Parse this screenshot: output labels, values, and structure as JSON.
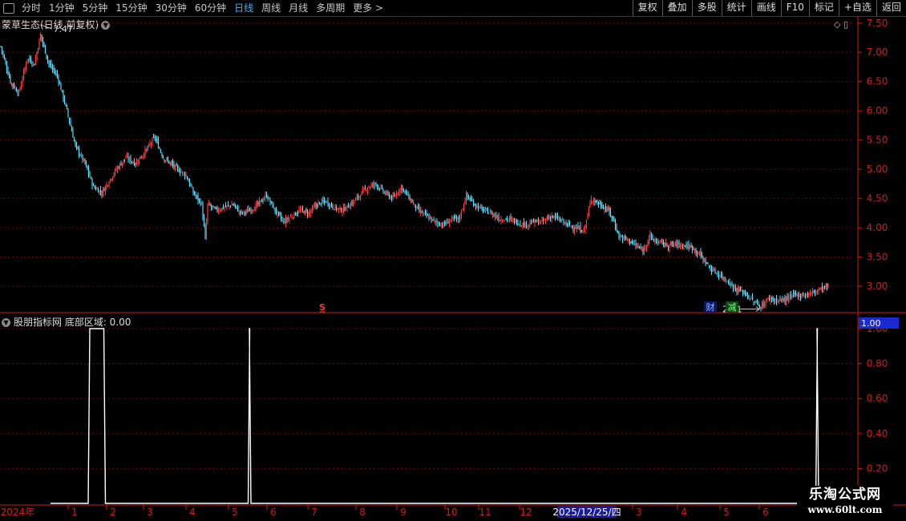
{
  "toolbar": {
    "periods": [
      "分时",
      "1分钟",
      "5分钟",
      "15分钟",
      "30分钟",
      "60分钟",
      "日线",
      "周线",
      "月线",
      "多周期",
      "更多 >"
    ],
    "active": "日线",
    "buttons": [
      "复权",
      "叠加",
      "多股",
      "统计",
      "画线",
      "F10",
      "标记",
      "+自选",
      "返回"
    ]
  },
  "main_title": "蒙草生态(日线 前复权)",
  "indicator_title": "股朋指标网 底部区域: 0.00",
  "top_icons": "◇ ▯",
  "watermark": {
    "line1": "乐淘公式网",
    "line2": "www.60lt.com"
  },
  "colors": {
    "up": "#ff3c3c",
    "down": "#54e0ff",
    "axis": "#d01c1c",
    "grid": "#7a0000",
    "indicator": "#ffffff",
    "date_highlight": "#1a1aa0"
  },
  "chart_data": [
    {
      "type": "candlestick",
      "y_ticks": [
        "7.50",
        "7.00",
        "6.50",
        "6.00",
        "5.50",
        "5.00",
        "4.50",
        "4.00",
        "3.50",
        "3.00"
      ],
      "ylim": [
        2.55,
        7.62
      ],
      "high_label": "7.47",
      "low_label": "2.61",
      "markers": [
        "S",
        "财",
        "减"
      ],
      "close_path": [
        [
          0,
          7.1
        ],
        [
          8,
          6.5
        ],
        [
          15,
          6.3
        ],
        [
          22,
          6.9
        ],
        [
          28,
          6.8
        ],
        [
          33,
          7.3
        ],
        [
          40,
          6.8
        ],
        [
          47,
          6.6
        ],
        [
          55,
          6.0
        ],
        [
          62,
          5.4
        ],
        [
          70,
          5.1
        ],
        [
          77,
          4.7
        ],
        [
          84,
          4.6
        ],
        [
          90,
          4.8
        ],
        [
          96,
          5.0
        ],
        [
          104,
          5.2
        ],
        [
          112,
          5.1
        ],
        [
          120,
          5.3
        ],
        [
          128,
          5.55
        ],
        [
          135,
          5.2
        ],
        [
          141,
          5.1
        ],
        [
          147,
          5.0
        ],
        [
          154,
          4.9
        ],
        [
          160,
          4.6
        ],
        [
          167,
          4.4
        ],
        [
          170,
          3.8
        ],
        [
          172,
          4.4
        ],
        [
          179,
          4.3
        ],
        [
          186,
          4.35
        ],
        [
          193,
          4.4
        ],
        [
          200,
          4.25
        ],
        [
          207,
          4.3
        ],
        [
          214,
          4.4
        ],
        [
          221,
          4.55
        ],
        [
          228,
          4.3
        ],
        [
          235,
          4.1
        ],
        [
          242,
          4.2
        ],
        [
          249,
          4.3
        ],
        [
          256,
          4.25
        ],
        [
          263,
          4.4
        ],
        [
          270,
          4.45
        ],
        [
          277,
          4.35
        ],
        [
          284,
          4.3
        ],
        [
          291,
          4.4
        ],
        [
          298,
          4.55
        ],
        [
          305,
          4.7
        ],
        [
          312,
          4.75
        ],
        [
          319,
          4.6
        ],
        [
          326,
          4.5
        ],
        [
          333,
          4.7
        ],
        [
          340,
          4.5
        ],
        [
          347,
          4.3
        ],
        [
          354,
          4.2
        ],
        [
          361,
          4.1
        ],
        [
          368,
          4.05
        ],
        [
          375,
          4.15
        ],
        [
          381,
          4.15
        ],
        [
          387,
          4.55
        ],
        [
          394,
          4.4
        ],
        [
          401,
          4.3
        ],
        [
          408,
          4.25
        ],
        [
          415,
          4.15
        ],
        [
          422,
          4.15
        ],
        [
          429,
          4.1
        ],
        [
          436,
          4.05
        ],
        [
          443,
          4.1
        ],
        [
          450,
          4.1
        ],
        [
          457,
          4.2
        ],
        [
          464,
          4.15
        ],
        [
          471,
          4.05
        ],
        [
          478,
          4.0
        ],
        [
          485,
          3.95
        ],
        [
          491,
          4.5
        ],
        [
          498,
          4.4
        ],
        [
          505,
          4.3
        ],
        [
          510,
          4.1
        ],
        [
          514,
          3.85
        ],
        [
          521,
          3.8
        ],
        [
          528,
          3.7
        ],
        [
          534,
          3.6
        ],
        [
          540,
          3.9
        ],
        [
          541,
          3.8
        ],
        [
          548,
          3.75
        ],
        [
          555,
          3.7
        ],
        [
          562,
          3.72
        ],
        [
          569,
          3.7
        ],
        [
          576,
          3.65
        ],
        [
          583,
          3.5
        ],
        [
          590,
          3.3
        ],
        [
          597,
          3.2
        ],
        [
          604,
          3.1
        ],
        [
          611,
          2.95
        ],
        [
          618,
          2.9
        ],
        [
          625,
          2.75
        ],
        [
          632,
          2.65
        ],
        [
          639,
          2.8
        ],
        [
          646,
          2.75
        ],
        [
          653,
          2.78
        ],
        [
          660,
          2.85
        ],
        [
          667,
          2.85
        ],
        [
          674,
          2.88
        ],
        [
          681,
          2.95
        ],
        [
          688,
          3.0
        ]
      ]
    },
    {
      "type": "line",
      "name": "底部区域",
      "value": "0.00",
      "current_value_label": "1.00",
      "y_ticks": [
        "1.00",
        "0.80",
        "0.60",
        "0.40",
        "0.20"
      ],
      "ylim": [
        0,
        1
      ],
      "x_ticks": [
        "2024年",
        "1",
        "2",
        "3",
        "4",
        "5",
        "6",
        "7",
        "8",
        "9",
        "10",
        "11",
        "12",
        "2025/12/25/四",
        "3",
        "4",
        "5",
        "6"
      ],
      "pulses": [
        [
          32,
          45
        ],
        [
          165,
          166
        ],
        [
          637,
          638
        ]
      ]
    }
  ]
}
